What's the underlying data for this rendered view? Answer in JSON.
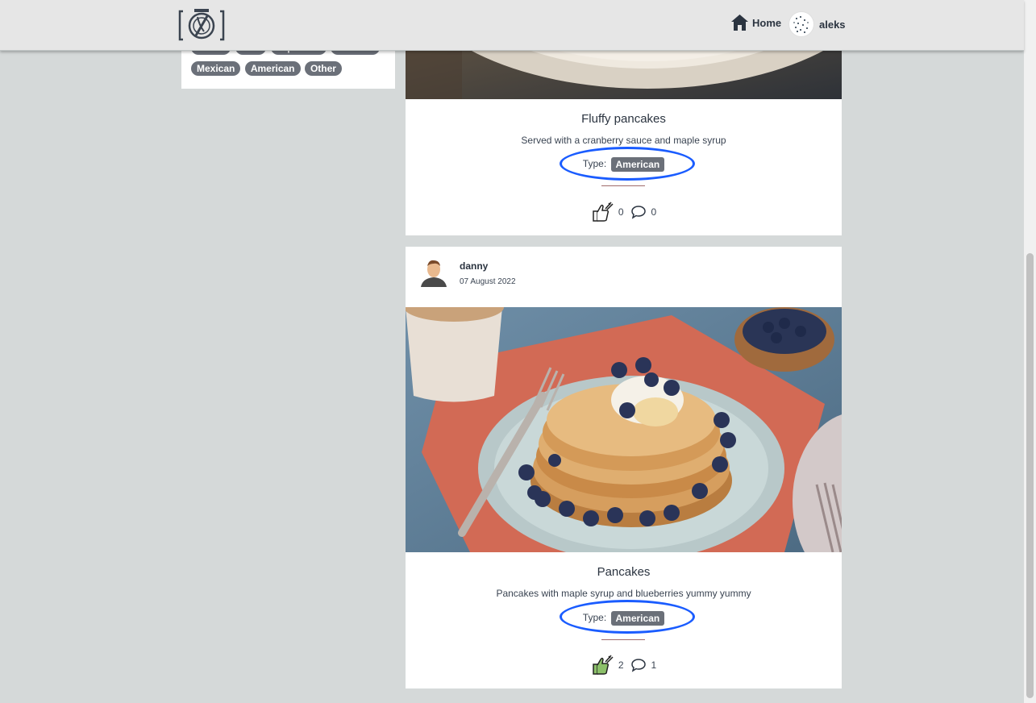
{
  "header": {
    "home_label": "Home",
    "user_label": "aleks"
  },
  "filters": {
    "row1": [
      "Indian",
      "Thai",
      "Japanese",
      "Chinese"
    ],
    "row2": [
      "Mexican",
      "American",
      "Other"
    ]
  },
  "posts": [
    {
      "title": "Fluffy pancakes",
      "description": "Served with a cranberry sauce and maple syrup",
      "type_label": "Type:",
      "type_value": "American",
      "likes": "0",
      "comments": "0"
    },
    {
      "author": "danny",
      "date": "07 August 2022",
      "title": "Pancakes",
      "description": "Pancakes with maple syrup and blueberries yummy yummy",
      "type_label": "Type:",
      "type_value": "American",
      "likes": "2",
      "comments": "1"
    }
  ],
  "colors": {
    "background": "#d5d9d9",
    "tag_bg": "#6b7079",
    "highlight_ellipse": "#1a5cff",
    "header_bg": "#e6e6e6"
  },
  "icons": [
    "camera-plate-logo-icon",
    "home-icon",
    "like-fork-icon",
    "comment-icon"
  ]
}
